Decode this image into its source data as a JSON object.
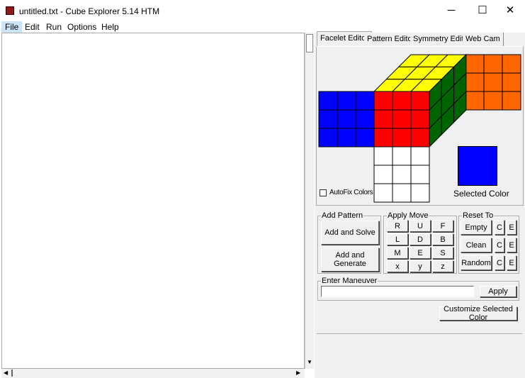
{
  "window": {
    "title": "untitled.txt - Cube Explorer 5.14 HTM",
    "minimize": "─",
    "maximize": "☐",
    "close": "✕"
  },
  "menu": [
    "File",
    "Edit",
    "Run",
    "Options",
    "Help"
  ],
  "tabs": [
    "Facelet Editor",
    "Pattern Editor",
    "Symmetry Editor",
    "Web Cam"
  ],
  "colors": {
    "U": "#ffff00",
    "R": "#006400",
    "F": "#ff0000",
    "D": "#ffffff",
    "L": "#0000ff",
    "B": "#ff6600",
    "selected": "#0000ff"
  },
  "facelet": {
    "autofix_label": "AutoFix Colors",
    "autofix_checked": false,
    "selected_color_label": "Selected Color"
  },
  "add_pattern": {
    "label": "Add Pattern",
    "solve": "Add and Solve",
    "generate": "Add and Generate"
  },
  "apply_move": {
    "label": "Apply Move",
    "moves": [
      "R",
      "U",
      "F",
      "L",
      "D",
      "B",
      "M",
      "E",
      "S",
      "x",
      "y",
      "z"
    ]
  },
  "reset_to": {
    "label": "Reset To",
    "items": [
      {
        "label": "Empty",
        "c": "C",
        "e": "E"
      },
      {
        "label": "Clean",
        "c": "C",
        "e": "E"
      },
      {
        "label": "Random",
        "c": "C",
        "e": "E"
      }
    ]
  },
  "maneuver": {
    "label": "Enter Maneuver",
    "value": "",
    "apply": "Apply"
  },
  "customize": "Customize Selected Color"
}
